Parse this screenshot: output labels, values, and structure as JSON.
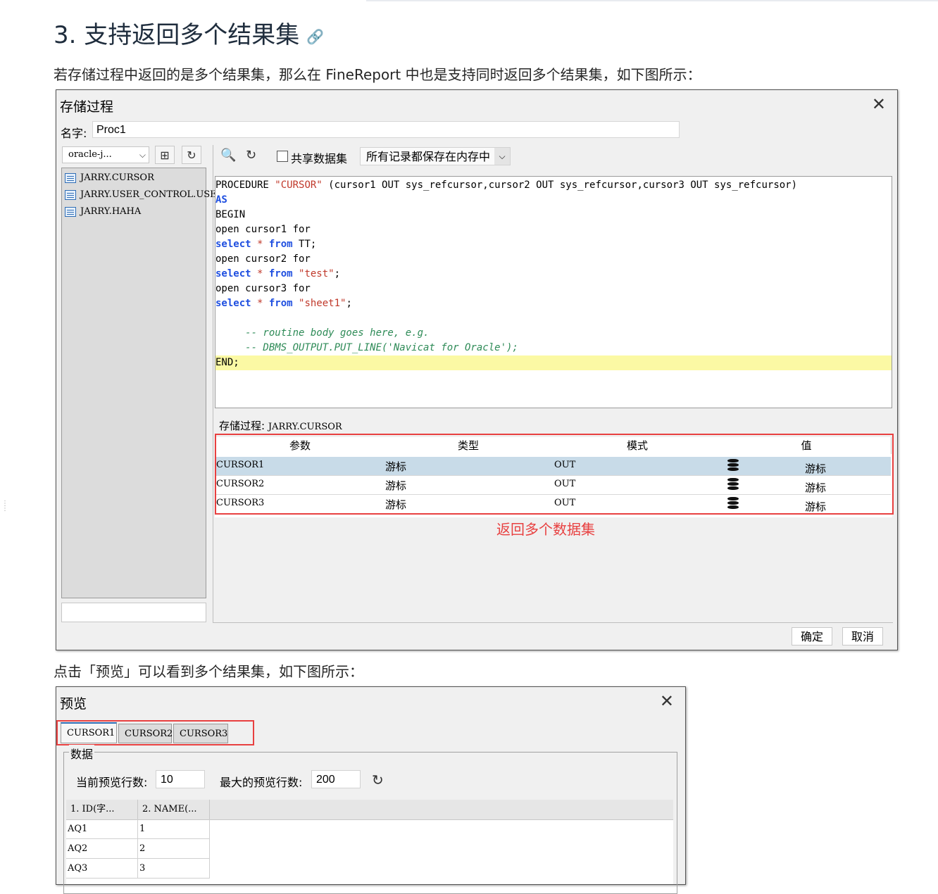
{
  "doc": {
    "heading": "3. 支持返回多个结果集",
    "heading_icon": "link-icon",
    "para1": "若存储过程中返回的是多个结果集，那么在 FineReport 中也是支持同时返回多个结果集，如下图所示：",
    "para2": "点击「预览」可以看到多个结果集，如下图所示："
  },
  "dialog1": {
    "title": "存储过程",
    "close": "✕",
    "name_label": "名字:",
    "name_value": "Proc1",
    "datasource": "oracle-j...",
    "tree": [
      "JARRY.CURSOR",
      "JARRY.USER_CONTROL.USE",
      "JARRY.HAHA"
    ],
    "share_label": "共享数据集",
    "memory_option": "所有记录都保存在内存中",
    "code": {
      "l1a": "PROCEDURE ",
      "l1b": "\"CURSOR\"",
      "l1c": " (cursor1 OUT sys_refcursor,cursor2 OUT sys_refcursor,cursor3 OUT sys_refcursor)",
      "l2": "AS",
      "l3": "BEGIN",
      "l4": "open cursor1 for",
      "select": "select",
      "star": " * ",
      "from": "from",
      "t1": " TT;",
      "l6": "open cursor2 for",
      "t2": " \"test\"",
      "semi": ";",
      "l8": "open cursor3 for",
      "t3": " \"sheet1\"",
      "c1": "     -- routine body goes here, e.g.",
      "c2": "     -- DBMS_OUTPUT.PUT_LINE('Navicat for Oracle');",
      "end": "END;"
    },
    "proc_label": "存储过程:",
    "proc_name": "JARRY.CURSOR",
    "param_headers": [
      "参数",
      "类型",
      "模式",
      "值"
    ],
    "params": [
      {
        "name": "CURSOR1",
        "type": "游标",
        "mode": "OUT",
        "value": "游标"
      },
      {
        "name": "CURSOR2",
        "type": "游标",
        "mode": "OUT",
        "value": "游标"
      },
      {
        "name": "CURSOR3",
        "type": "游标",
        "mode": "OUT",
        "value": "游标"
      }
    ],
    "annotation": "返回多个数据集",
    "ok": "确定",
    "cancel": "取消"
  },
  "dialog2": {
    "title": "预览",
    "close": "✕",
    "tabs": [
      "CURSOR1",
      "CURSOR2",
      "CURSOR3"
    ],
    "group_label": "数据",
    "current_rows_label": "当前预览行数:",
    "current_rows": "10",
    "max_rows_label": "最大的预览行数:",
    "max_rows": "200",
    "columns": [
      "1. ID(字...",
      "2. NAME(..."
    ],
    "rows": [
      [
        "AQ1",
        "1"
      ],
      [
        "AQ2",
        "2"
      ],
      [
        "AQ3",
        "3"
      ]
    ]
  },
  "colors": {
    "highlight_red": "#e84040",
    "keyword_blue": "#1f4fe0",
    "code_highlight": "#fbf9a4"
  }
}
